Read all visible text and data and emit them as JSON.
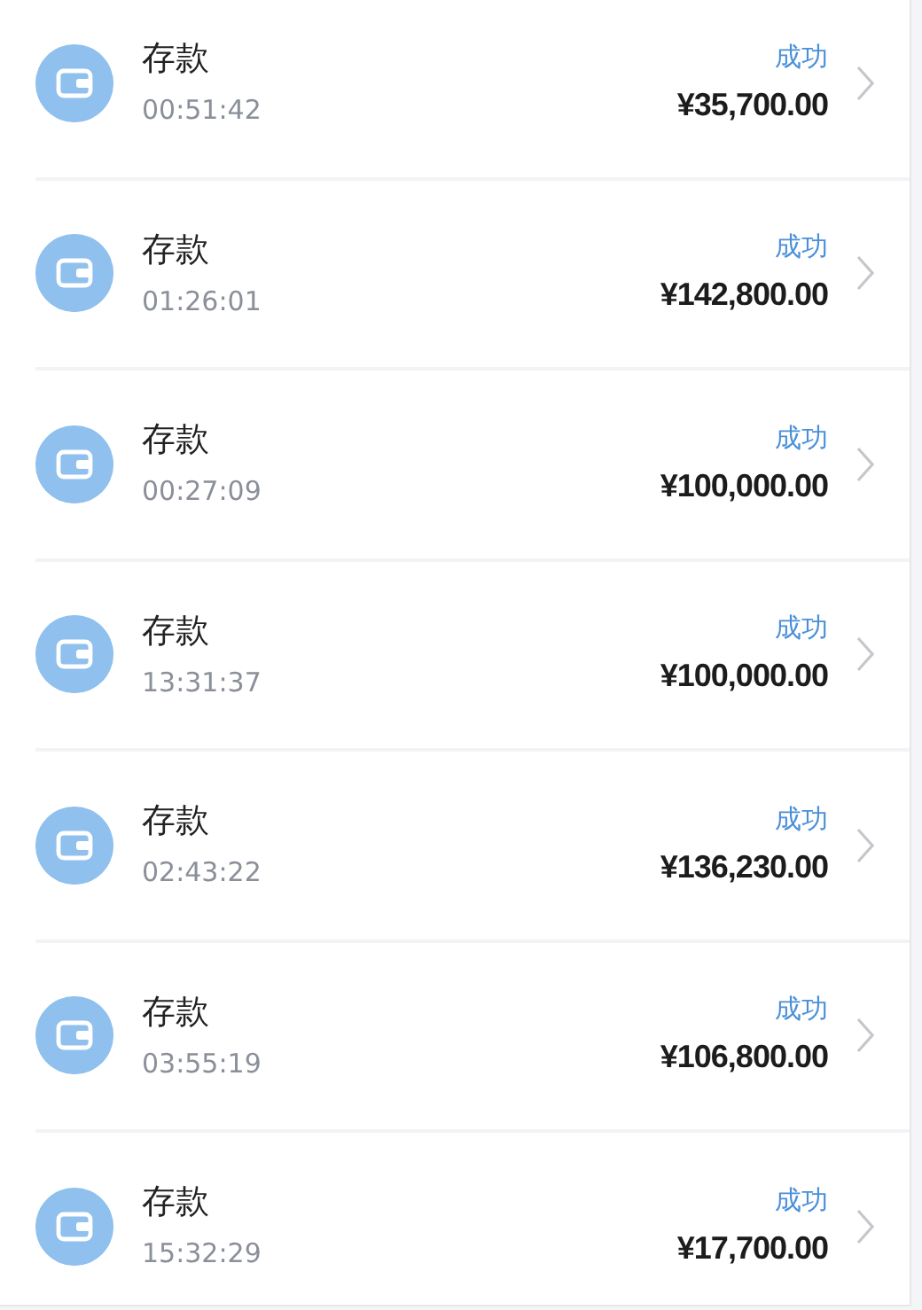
{
  "records": [
    {
      "title": "存款",
      "time": "00:51:42",
      "status": "成功",
      "amount": "¥35,700.00"
    },
    {
      "title": "存款",
      "time": "01:26:01",
      "status": "成功",
      "amount": "¥142,800.00"
    },
    {
      "title": "存款",
      "time": "00:27:09",
      "status": "成功",
      "amount": "¥100,000.00"
    },
    {
      "title": "存款",
      "time": "13:31:37",
      "status": "成功",
      "amount": "¥100,000.00"
    },
    {
      "title": "存款",
      "time": "02:43:22",
      "status": "成功",
      "amount": "¥136,230.00"
    },
    {
      "title": "存款",
      "time": "03:55:19",
      "status": "成功",
      "amount": "¥106,800.00"
    },
    {
      "title": "存款",
      "time": "15:32:29",
      "status": "成功",
      "amount": "¥17,700.00"
    }
  ]
}
